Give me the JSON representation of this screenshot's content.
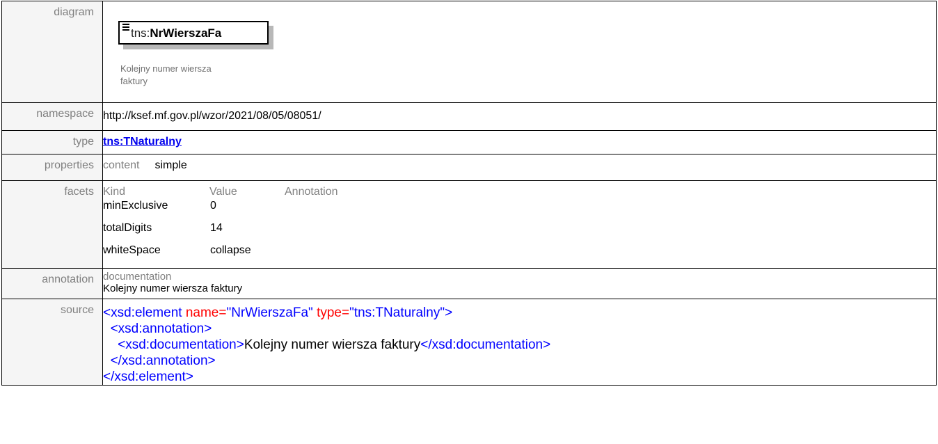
{
  "rows": {
    "diagram": {
      "label": "diagram",
      "element_prefix": "tns:",
      "element_local": "NrWierszaFa",
      "element_doc": "Kolejny numer wiersza faktury"
    },
    "namespace": {
      "label": "namespace",
      "value": "http://ksef.mf.gov.pl/wzor/2021/08/05/08051/"
    },
    "type": {
      "label": "type",
      "value": "tns:TNaturalny"
    },
    "properties": {
      "label": "properties",
      "key": "content",
      "value": "simple"
    },
    "facets": {
      "label": "facets",
      "headers": [
        "Kind",
        "Value",
        "Annotation"
      ],
      "items": [
        {
          "kind": "minExclusive",
          "value": "0"
        },
        {
          "kind": "totalDigits",
          "value": "14"
        },
        {
          "kind": "whiteSpace",
          "value": "collapse"
        }
      ]
    },
    "annotation": {
      "label": "annotation",
      "heading": "documentation",
      "text": "Kolejny numer wiersza faktury"
    },
    "source": {
      "label": "source",
      "line1": {
        "open": "<xsd:element ",
        "attr1": "name=",
        "val1": "\"NrWierszaFa\" ",
        "attr2": "type=",
        "val2": "\"tns:TNaturalny\"",
        "close": ">"
      },
      "line2": "<xsd:annotation>",
      "line3": {
        "open": "<xsd:documentation>",
        "text": "Kolejny numer wiersza faktury",
        "close": "</xsd:documentation>"
      },
      "line4": "</xsd:annotation>",
      "line5": "</xsd:element>"
    }
  }
}
